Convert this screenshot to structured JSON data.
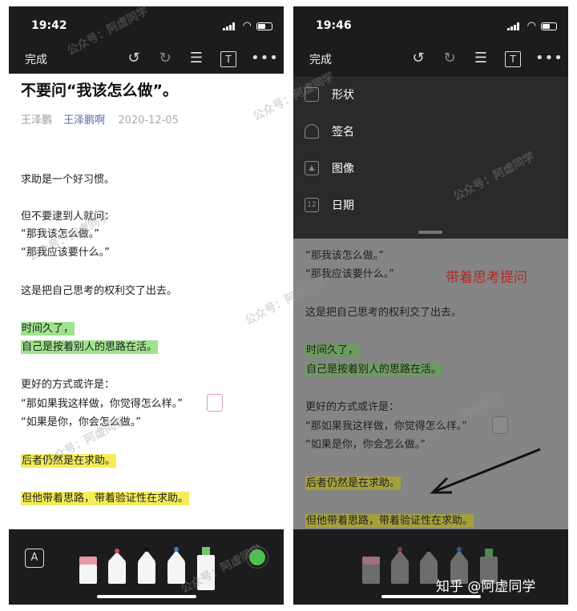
{
  "left": {
    "time": "19:42",
    "toolbar": {
      "done": "完成",
      "text_icon_glyph": "T",
      "more_glyph": "•••"
    },
    "article": {
      "title": "不要问“我该怎么做”。",
      "author": "王泽鹏",
      "nickname": "王泽鹏啊",
      "date": "2020-12-05",
      "lines": [
        "求助是一个好习惯。",
        "但不要逮到人就问：",
        "“那我该怎么做。”",
        "“那我应该要什么。”",
        "这是把自己思考的权利交了出去。",
        "时间久了，",
        "自己是按着别人的思路在活。",
        "更好的方式或许是：",
        "“那如果我这样做，你觉得怎么样。”",
        "“如果是你，你会怎么做。”",
        "后者仍然是在求助。",
        "但他带着思路，带着验证性在求助。"
      ]
    },
    "dock": {
      "text_tool_glyph": "A"
    }
  },
  "right": {
    "time": "19:46",
    "toolbar": {
      "done": "完成",
      "text_icon_glyph": "T",
      "more_glyph": "•••"
    },
    "menu": [
      {
        "label": "形状",
        "icon": "shape-icon"
      },
      {
        "label": "签名",
        "icon": "signature-icon"
      },
      {
        "label": "图像",
        "icon": "image-icon"
      },
      {
        "label": "日期",
        "icon": "calendar-icon",
        "glyph": "12"
      }
    ],
    "annotation": "带着思考提问",
    "lines": [
      "“那我该怎么做。”",
      "“那我应该要什么。”",
      "这是把自己思考的权利交了出去。",
      "时间久了，",
      "自己是按着别人的思路在活。",
      "更好的方式或许是：",
      "“那如果我这样做，你觉得怎么样。”",
      "“如果是你，你会怎么做。”",
      "后者仍然是在求助。",
      "但他带着思路，带着验证性在求助。"
    ]
  },
  "watermark": {
    "text": "公众号：阿虚同学",
    "credit": "知乎 @阿虚同学"
  },
  "colors": {
    "highlight_green": "#9fe38e",
    "highlight_yellow": "#f4ec5a",
    "annotation_red": "#b02a2a",
    "author_link": "#5a6ca8"
  }
}
